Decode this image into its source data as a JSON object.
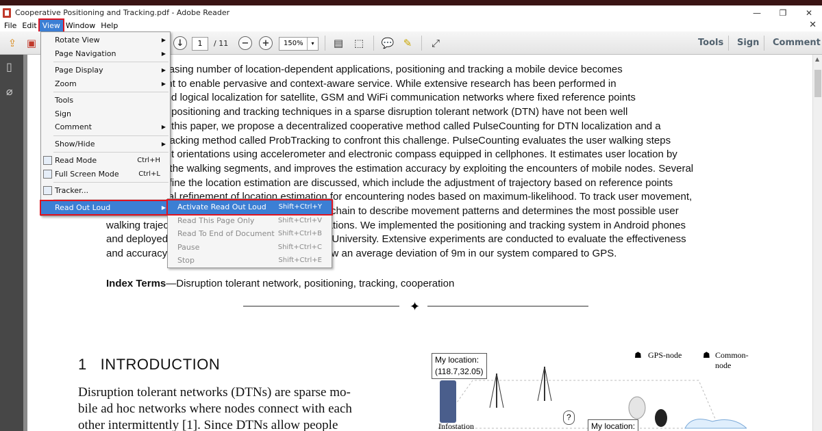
{
  "window": {
    "title": "Cooperative Positioning and Tracking.pdf - Adobe Reader",
    "minimize": "—",
    "restore": "❐",
    "close": "✕"
  },
  "menubar": {
    "items": [
      "File",
      "Edit",
      "View",
      "Window",
      "Help"
    ],
    "doc_close": "✕"
  },
  "toolbar": {
    "page_current": "1",
    "page_total": "/ 11",
    "zoom": "150%",
    "zoom_dropdown": "▾",
    "tools": "Tools",
    "sign": "Sign",
    "comment": "Comment"
  },
  "view_menu": {
    "items": [
      {
        "label": "Rotate View",
        "submenu": true
      },
      {
        "label": "Page Navigation",
        "submenu": true
      },
      {
        "sep": true
      },
      {
        "label": "Page Display",
        "submenu": true
      },
      {
        "label": "Zoom",
        "submenu": true
      },
      {
        "sep": true
      },
      {
        "label": "Tools"
      },
      {
        "label": "Sign"
      },
      {
        "label": "Comment",
        "submenu": true
      },
      {
        "sep": true
      },
      {
        "label": "Show/Hide",
        "submenu": true
      },
      {
        "sep": true
      },
      {
        "label": "Read Mode",
        "shortcut": "Ctrl+H"
      },
      {
        "label": "Full Screen Mode",
        "shortcut": "Ctrl+L"
      },
      {
        "sep": true
      },
      {
        "label": "Tracker..."
      },
      {
        "sep": true
      },
      {
        "label": "Read Out Loud",
        "submenu": true
      }
    ]
  },
  "read_out_loud_menu": {
    "items": [
      {
        "label": "Activate Read Out Loud",
        "shortcut": "Shift+Ctrl+Y"
      },
      {
        "label": "Read This Page Only",
        "shortcut": "Shift+Ctrl+V"
      },
      {
        "label": "Read To End of Document",
        "shortcut": "Shift+Ctrl+B"
      },
      {
        "label": "Pause",
        "shortcut": "Shift+Ctrl+C"
      },
      {
        "label": "Stop",
        "shortcut": "Shift+Ctrl+E"
      }
    ]
  },
  "document": {
    "abstract_lines": [
      "With the increasing number of location-dependent applications, positioning and tracking a mobile device becomes",
      "more important to enable pervasive and context-aware service. While extensive research has been performed in",
      "localization and logical localization for satellite, GSM and WiFi communication networks where fixed reference points",
      "are deployed, positioning and tracking techniques in a sparse disruption tolerant network (DTN) have not been well",
      "addressed. In this paper, we propose a decentralized cooperative method called PulseCounting for DTN localization and a",
      "probabilistic tracking method called ProbTracking to confront this challenge. PulseCounting evaluates the user walking steps",
      "and movement orientations using accelerometer and electronic compass equipped in cellphones. It estimates user location by",
      "accumulating the walking segments, and improves the estimation accuracy by exploiting the encounters of mobile nodes. Several",
      "methods to refine the location estimation are discussed, which include the adjustment of trajectory based on reference points",
      "and the optimal refinement of location estimation for encountering nodes based on maximum-likelihood. To track user movement,",
      "the proposed ProbTracking method uses Markov chain to describe movement patterns and determines the most possible user",
      "walking trajectories without full record of user locations. We implemented the positioning and tracking system in Android phones",
      "and deployed a testbed in the campus of Nanjing University. Extensive experiments are conducted to evaluate the effectiveness",
      "and accuracy of our methods, and the results show an average deviation of 9m in our system compared to GPS."
    ],
    "index_terms_label": "Index Terms",
    "index_terms_text": "—Disruption tolerant network, positioning, tracking, cooperation",
    "section_number": "1",
    "section_title": "INTRODUCTION",
    "intro_lines": [
      "Disruption tolerant networks (DTNs) are sparse mo-",
      "bile ad hoc networks where nodes connect with each",
      "other intermittently [1]. Since DTNs allow people"
    ],
    "figure": {
      "my_location_1": "My location:",
      "my_location_1_value": "(118.7,32.05)",
      "gps_node": "GPS-node",
      "common_node": "Common-node",
      "infostation": "Infostation",
      "question": "?",
      "my_location_2": "My location:"
    }
  }
}
